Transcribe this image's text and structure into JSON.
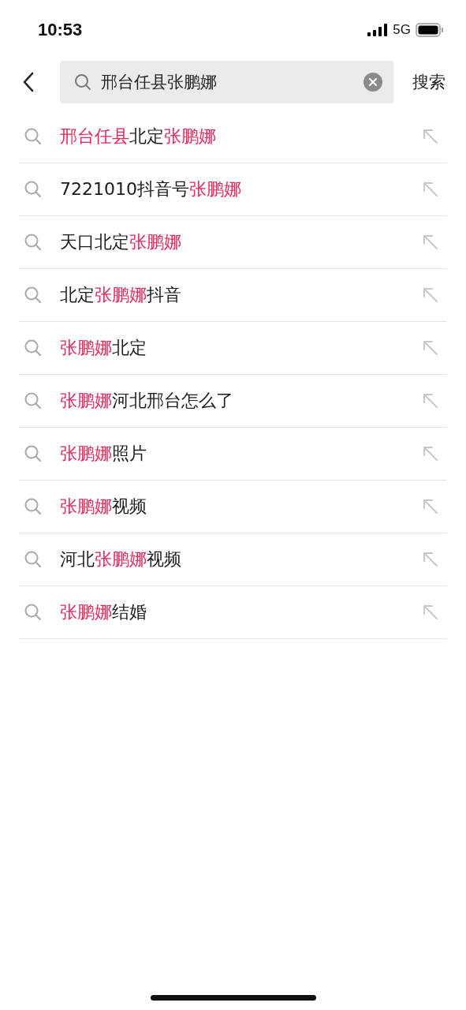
{
  "status_bar": {
    "time": "10:53",
    "network": "5G"
  },
  "search": {
    "value": "邢台任县张鹏娜",
    "action": "搜索"
  },
  "suggestions": [
    {
      "parts": [
        {
          "text": "邢台任县",
          "highlighted": true
        },
        {
          "text": "北定",
          "highlighted": false
        },
        {
          "text": "张鹏娜",
          "highlighted": true
        }
      ]
    },
    {
      "parts": [
        {
          "text": "7221010抖音号",
          "highlighted": false
        },
        {
          "text": "张鹏娜",
          "highlighted": true
        }
      ]
    },
    {
      "parts": [
        {
          "text": "天口北定",
          "highlighted": false
        },
        {
          "text": "张鹏娜",
          "highlighted": true
        }
      ]
    },
    {
      "parts": [
        {
          "text": "北定",
          "highlighted": false
        },
        {
          "text": "张鹏娜",
          "highlighted": true
        },
        {
          "text": "抖音",
          "highlighted": false
        }
      ]
    },
    {
      "parts": [
        {
          "text": "张鹏娜",
          "highlighted": true
        },
        {
          "text": "北定",
          "highlighted": false
        }
      ]
    },
    {
      "parts": [
        {
          "text": "张鹏娜",
          "highlighted": true
        },
        {
          "text": "河北邢台怎么了",
          "highlighted": false
        }
      ]
    },
    {
      "parts": [
        {
          "text": "张鹏娜",
          "highlighted": true
        },
        {
          "text": "照片",
          "highlighted": false
        }
      ]
    },
    {
      "parts": [
        {
          "text": "张鹏娜",
          "highlighted": true
        },
        {
          "text": "视频",
          "highlighted": false
        }
      ]
    },
    {
      "parts": [
        {
          "text": "河北",
          "highlighted": false
        },
        {
          "text": "张鹏娜",
          "highlighted": true
        },
        {
          "text": "视频",
          "highlighted": false
        }
      ]
    },
    {
      "parts": [
        {
          "text": "张鹏娜",
          "highlighted": true
        },
        {
          "text": "结婚",
          "highlighted": false
        }
      ]
    }
  ]
}
